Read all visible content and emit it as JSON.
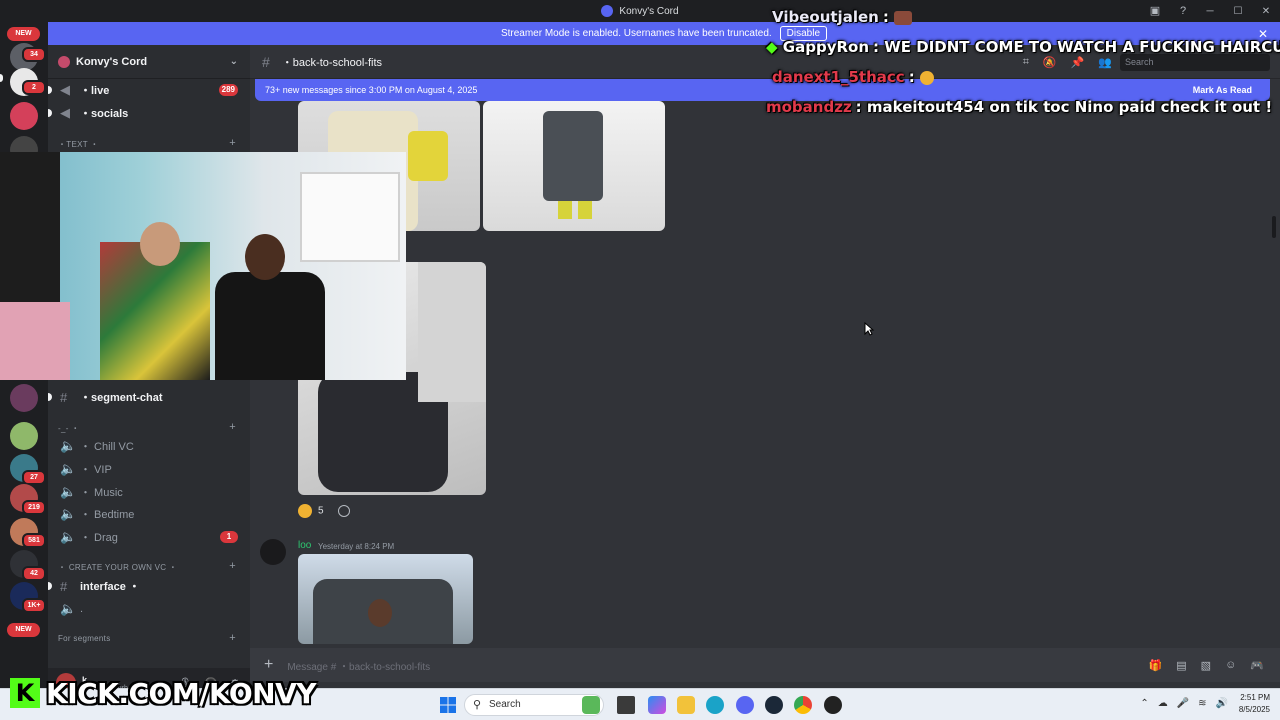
{
  "window": {
    "title": "Konvy's Cord"
  },
  "banner": {
    "text": "Streamer Mode is enabled. Usernames have been truncated.",
    "disable_label": "Disable"
  },
  "rail": {
    "new_top": "NEW",
    "new_bottom": "NEW",
    "badges": [
      "34",
      "2",
      "27",
      "219",
      "581",
      "42",
      "1K+"
    ]
  },
  "sidebar": {
    "server_name": "Konvy's Cord",
    "channels_top": [
      {
        "label": "・live",
        "count": "289"
      },
      {
        "label": "・socials"
      }
    ],
    "category_text": "・TEXT ・",
    "segment_chat": "・segment-chat",
    "category_voice": "-_- ・",
    "voice_channels": [
      {
        "label": "・ Chill VC"
      },
      {
        "label": "・ VIP"
      },
      {
        "label": "・ Music"
      },
      {
        "label": "・ Bedtime"
      },
      {
        "label": "・ Drag",
        "count": "1"
      }
    ],
    "category_create": "・ CREATE YOUR OWN VC ・",
    "interface": "interface ・",
    "voice_dot": ".",
    "category_segments": "For segments",
    "user": {
      "name": "k...",
      "status": "Do Not Disturb"
    }
  },
  "chat": {
    "channel_name": "・back-to-school-fits",
    "search_placeholder": "Search",
    "new_messages": "73+ new messages since 3:00 PM on August 4, 2025",
    "mark_as_read": "Mark As Read",
    "reaction_count": "5",
    "author": "loo",
    "timestamp": "Yesterday at 8:24 PM",
    "composer_placeholder": "Message # ・back-to-school-fits"
  },
  "overlay_chat": [
    {
      "user": "Vibeoutjalen",
      "message": "",
      "color": "#e9e9f5"
    },
    {
      "user": "GappyRon",
      "message": "WE DIDNT COME TO WATCH A FUCKING HAIRCUT",
      "color": "#ffffff"
    },
    {
      "user": "danext1_5thacc",
      "message": "",
      "color": "#e23a4b"
    },
    {
      "user": "mobandzz",
      "message": "makeitout454 on tik toc Nino paid check it out !",
      "color": "#e23a4b"
    }
  ],
  "watermark": {
    "k": "K",
    "url": "KICK.COM/KONVY"
  },
  "taskbar": {
    "search": "Search",
    "time": "2:51 PM",
    "date": "8/5/2025"
  },
  "colors": {
    "blurple": "#5865f2",
    "unread_red": "#da373c",
    "author_green": "#2dc770",
    "kick_green": "#53fc18"
  }
}
